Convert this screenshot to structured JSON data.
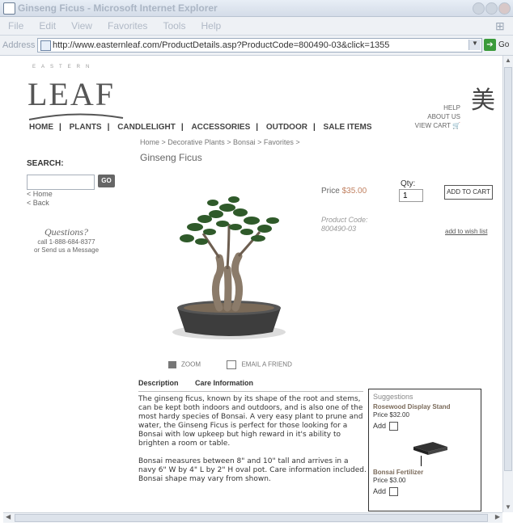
{
  "window": {
    "title": "Ginseng Ficus - Microsoft Internet Explorer"
  },
  "menubar": {
    "items": [
      "File",
      "Edit",
      "View",
      "Favorites",
      "Tools",
      "Help"
    ]
  },
  "addressbar": {
    "label": "Address",
    "url": "http://www.easternleaf.com/ProductDetails.asp?ProductCode=800490-03&click=1355",
    "go_label": "Go"
  },
  "site": {
    "logo_top": "EASTERN",
    "logo_main": "LEAF",
    "kanji": "美",
    "util_links": [
      "HELP",
      "ABOUT US",
      "VIEW CART 🛒"
    ],
    "nav": [
      "HOME",
      "PLANTS",
      "CANDLELIGHT",
      "ACCESSORIES",
      "OUTDOOR",
      "SALE ITEMS"
    ]
  },
  "sidebar": {
    "search_label": "SEARCH:",
    "go_label": "GO",
    "links": [
      "< Home",
      "< Back"
    ],
    "questions_title": "Questions?",
    "phone": "call 1-888-684-8377",
    "message": "or Send us a Message"
  },
  "product": {
    "breadcrumb": "Home > Decorative Plants > Bonsai > Favorites >",
    "title": "Ginseng Ficus",
    "price_label": "Price",
    "price_value": "$35.00",
    "qty_label": "Qty:",
    "qty_value": "1",
    "add_to_cart": "ADD TO CART",
    "code_label": "Product Code:",
    "code_value": "800490-03",
    "wishlist": "add to wish list",
    "zoom": "ZOOM",
    "email": "EMAIL A FRIEND",
    "tabs": [
      "Description",
      "Care Information"
    ],
    "description": [
      "The ginseng ficus, known by its shape of the root and stems, can be kept both indoors and outdoors, and is also one of the most hardy species of Bonsai. A very easy plant to prune and water, the Ginseng Ficus is perfect for those looking for a Bonsai with low upkeep but high reward in it's ability to brighten a room or table.",
      "Bonsai measures between 8\" and 10\" tall and arrives in a navy 6\" W by 4\" L by 2\" H oval pot. Care information included. Bonsai shape may vary from shown."
    ]
  },
  "suggestions": {
    "header": "Suggestions",
    "items": [
      {
        "name": "Rosewood Display Stand",
        "price": "Price $32.00",
        "add": "Add"
      },
      {
        "name": "Bonsai Fertilizer",
        "price": "Price $3.00",
        "add": "Add"
      }
    ]
  }
}
